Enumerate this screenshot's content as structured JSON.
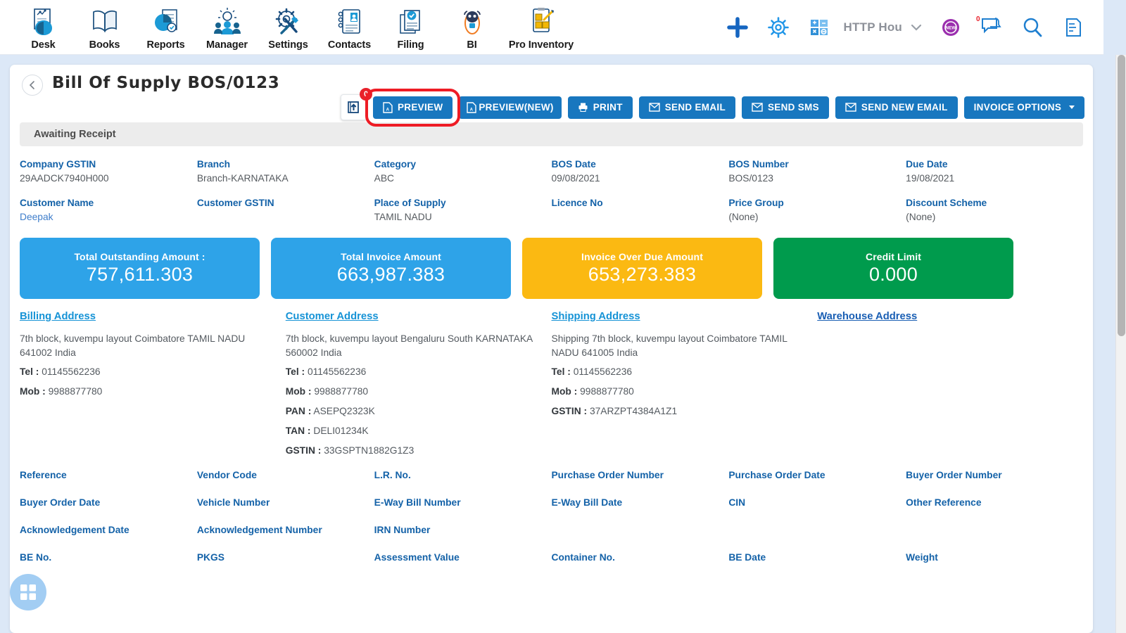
{
  "nav": {
    "items": [
      {
        "label": "Desk",
        "icon": "desk-chart-icon"
      },
      {
        "label": "Books",
        "icon": "books-icon"
      },
      {
        "label": "Reports",
        "icon": "reports-piechart-icon"
      },
      {
        "label": "Manager",
        "icon": "manager-people-icon"
      },
      {
        "label": "Settings",
        "icon": "settings-gear-wrench-icon"
      },
      {
        "label": "Contacts",
        "icon": "contacts-card-icon"
      },
      {
        "label": "Filing",
        "icon": "filing-documents-icon"
      },
      {
        "label": "BI",
        "icon": "bi-robot-icon"
      },
      {
        "label": "Pro Inventory",
        "icon": "pro-inventory-boxes-icon"
      }
    ],
    "right": {
      "add_icon": "plus-icon",
      "settings_icon": "gear-icon",
      "calculator_icon": "calculator-icon",
      "account_label": "HTTP Hou",
      "chevron_icon": "chevron-down-icon",
      "new_badge_icon": "new-badge-icon",
      "chat_icon": "chat-bell-icon",
      "chat_count": "0",
      "search_icon": "search-icon",
      "notes_icon": "notes-icon"
    }
  },
  "header": {
    "back_icon": "chevron-left-icon",
    "title": "Bill Of Supply BOS/0123"
  },
  "toolbar": {
    "upload_icon": "upload-folder-icon",
    "upload_count": "0",
    "buttons": [
      {
        "label": "PREVIEW",
        "icon": "pdf-file-icon",
        "highlighted": true
      },
      {
        "label": "PREVIEW(NEW)",
        "icon": "pdf-file-icon",
        "highlighted": false
      },
      {
        "label": "PRINT",
        "icon": "printer-icon",
        "highlighted": false
      },
      {
        "label": "SEND EMAIL",
        "icon": "envelope-icon",
        "highlighted": false
      },
      {
        "label": "SEND SMS",
        "icon": "envelope-icon",
        "highlighted": false
      },
      {
        "label": "SEND NEW EMAIL",
        "icon": "envelope-icon",
        "highlighted": false
      },
      {
        "label": "INVOICE OPTIONS",
        "icon": "caret-down-icon",
        "highlighted": false
      }
    ]
  },
  "status": {
    "text": "Awaiting Receipt"
  },
  "fields": {
    "row1": [
      {
        "label": "Company GSTIN",
        "value": "29AADCK7940H000",
        "link": false
      },
      {
        "label": "Branch",
        "value": "Branch-KARNATAKA",
        "link": false
      },
      {
        "label": "Category",
        "value": "ABC",
        "link": false
      },
      {
        "label": "BOS Date",
        "value": "09/08/2021",
        "link": false
      },
      {
        "label": "BOS Number",
        "value": "BOS/0123",
        "link": false
      },
      {
        "label": "Due Date",
        "value": "19/08/2021",
        "link": false
      }
    ],
    "row2": [
      {
        "label": "Customer Name",
        "value": "Deepak",
        "link": true
      },
      {
        "label": "Customer GSTIN",
        "value": "",
        "link": false
      },
      {
        "label": "Place of Supply",
        "value": "TAMIL NADU",
        "link": false
      },
      {
        "label": "Licence No",
        "value": "",
        "link": false
      },
      {
        "label": "Price Group",
        "value": "(None)",
        "link": false
      },
      {
        "label": "Discount Scheme",
        "value": "(None)",
        "link": false
      }
    ]
  },
  "amounts": [
    {
      "title": "Total Outstanding Amount :",
      "value": "757,611.303",
      "color": "#2ea3e8"
    },
    {
      "title": "Total Invoice Amount",
      "value": "663,987.383",
      "color": "#2ea3e8"
    },
    {
      "title": "Invoice Over Due Amount",
      "value": "653,273.383",
      "color": "#fbb912"
    },
    {
      "title": "Credit Limit",
      "value": "0.000",
      "color": "#009b4d"
    }
  ],
  "addresses": [
    {
      "title": "Billing Address",
      "dark": false,
      "text": "7th block, kuvempu layout Coimbatore TAMIL NADU 641002 India",
      "details": [
        {
          "key": "Tel :",
          "value": "01145562236"
        },
        {
          "key": "Mob :",
          "value": "9988877780"
        }
      ]
    },
    {
      "title": "Customer Address",
      "dark": false,
      "text": "7th block, kuvempu layout Bengaluru South KARNATAKA 560002 India",
      "details": [
        {
          "key": "Tel :",
          "value": "01145562236"
        },
        {
          "key": "Mob :",
          "value": "9988877780"
        },
        {
          "key": "PAN :",
          "value": "ASEPQ2323K"
        },
        {
          "key": "TAN :",
          "value": "DELI01234K"
        },
        {
          "key": "GSTIN :",
          "value": "33GSPTN1882G1Z3"
        }
      ]
    },
    {
      "title": "Shipping Address",
      "dark": false,
      "text": "Shipping 7th block, kuvempu layout Coimbatore TAMIL NADU 641005 India",
      "details": [
        {
          "key": "Tel :",
          "value": "01145562236"
        },
        {
          "key": "Mob :",
          "value": "9988877780"
        },
        {
          "key": "GSTIN :",
          "value": "37ARZPT4384A1Z1"
        }
      ]
    },
    {
      "title": "Warehouse Address",
      "dark": true,
      "text": "",
      "details": []
    }
  ],
  "bottom_rows": [
    [
      "Reference",
      "Vendor Code",
      "L.R. No.",
      "Purchase Order Number",
      "Purchase Order Date",
      "Buyer Order Number"
    ],
    [
      "Buyer Order Date",
      "Vehicle Number",
      "E-Way Bill Number",
      "E-Way Bill Date",
      "CIN",
      "Other Reference"
    ],
    [
      "Acknowledgement Date",
      "Acknowledgement Number",
      "IRN Number",
      "",
      "",
      ""
    ],
    [
      "BE No.",
      "PKGS",
      "Assessment Value",
      "Container No.",
      "BE Date",
      "Weight"
    ]
  ],
  "fab": {
    "icon": "grid-apps-icon"
  },
  "colors": {
    "brand_blue": "#1877bf",
    "label_blue": "#1462a8",
    "link_cyan": "#1693d6",
    "highlight_red": "#ee1c25",
    "card_blue": "#2ea3e8",
    "card_amber": "#fbb912",
    "card_green": "#009b4d"
  }
}
